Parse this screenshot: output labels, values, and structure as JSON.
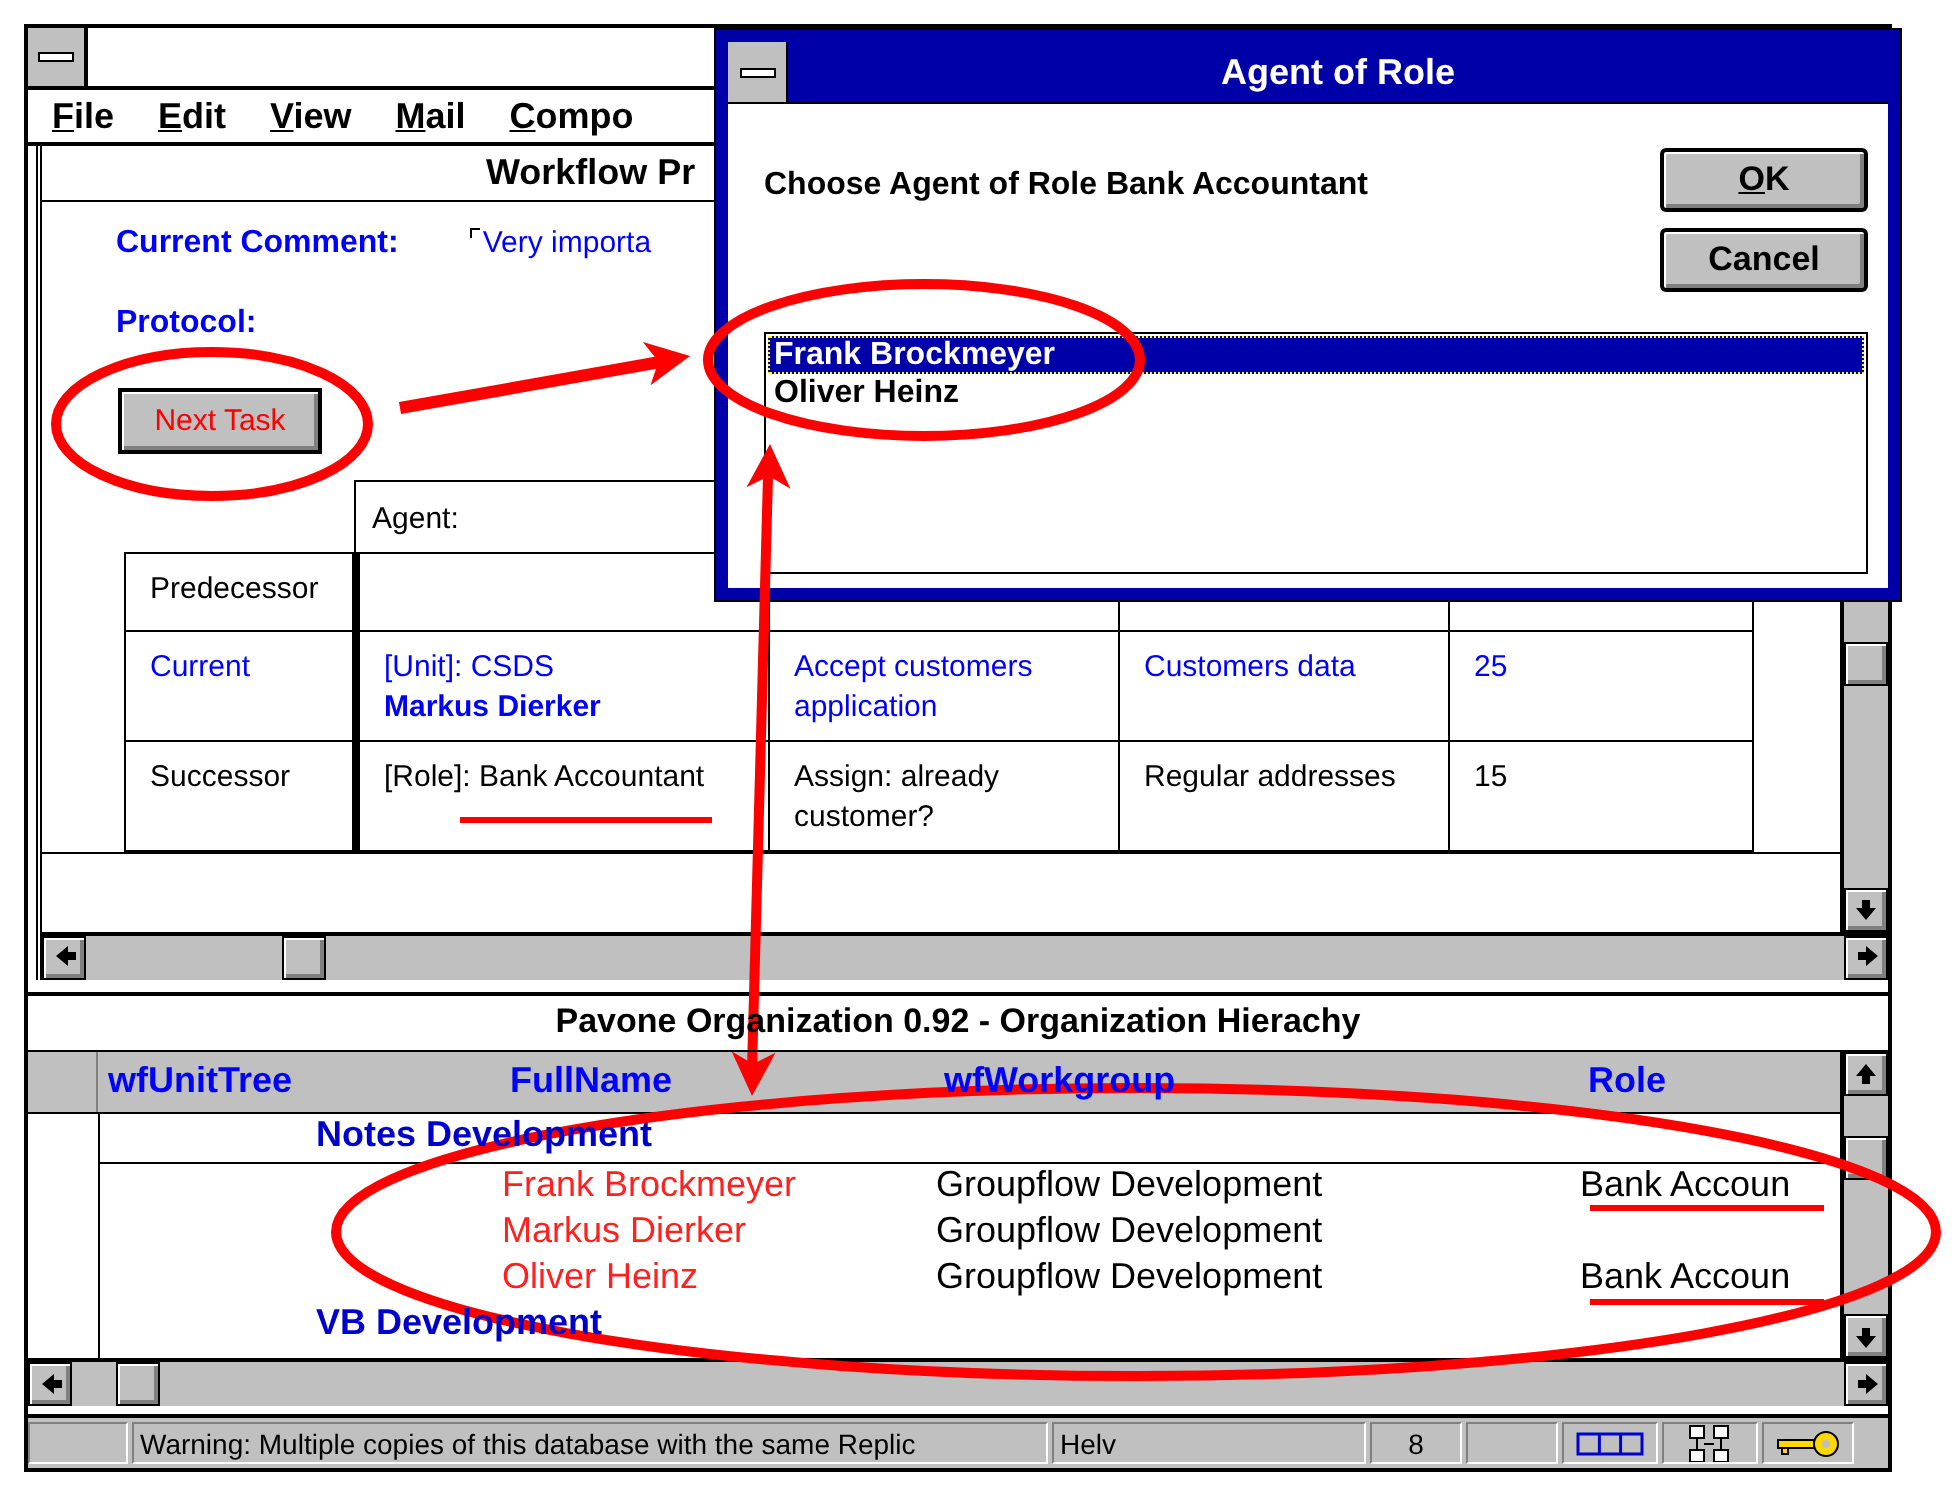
{
  "window": {
    "menu": [
      {
        "key": "F",
        "rest": "ile"
      },
      {
        "key": "E",
        "rest": "dit"
      },
      {
        "key": "V",
        "rest": "iew"
      },
      {
        "key": "M",
        "rest": "ail"
      },
      {
        "key": "C",
        "rest": "ompo"
      }
    ]
  },
  "workflow_form": {
    "title": "Workflow Pr",
    "comment_label": "Current Comment:",
    "comment_value": "Very importa",
    "protocol_label": "Protocol:",
    "next_task_button": "Next Task",
    "table": {
      "agent_header": "Agent:",
      "rows": [
        {
          "label": "Predecessor",
          "highlighted": false
        },
        {
          "label": "Current",
          "highlighted": true,
          "agent": "[Unit]: CSDS\n**Markus Dierker**",
          "task": "Accept customers application",
          "data": "Customers data",
          "column_5": "25"
        },
        {
          "label": "Successor",
          "highlighted": false,
          "agent": "[Role]: Bank Accountant",
          "task": "Assign: already customer?",
          "data": "Regular addresses",
          "column_5": "15"
        }
      ]
    }
  },
  "dialog": {
    "title": "Agent of Role",
    "prompt": "Choose Agent of Role Bank Accountant",
    "ok_button": {
      "key": "O",
      "rest": "K"
    },
    "cancel_button": "Cancel",
    "agents": [
      {
        "name": "Frank Brockmeyer",
        "selected": true
      },
      {
        "name": "Oliver Heinz",
        "selected": false
      }
    ]
  },
  "org_view": {
    "title": "Pavone Organization 0.92 - Organization Hierachy",
    "columns": [
      "wfUnitTree",
      "FullName",
      "wfWorkgroup",
      "Role"
    ],
    "rows": [
      {
        "kind": "category",
        "name": "Notes Development"
      },
      {
        "kind": "person",
        "full_name": "Frank Brockmeyer",
        "workgroup": "Groupflow Development",
        "role": "Bank Accoun"
      },
      {
        "kind": "person",
        "full_name": "Markus Dierker",
        "workgroup": "Groupflow Development"
      },
      {
        "kind": "person",
        "full_name": "Oliver Heinz",
        "workgroup": "Groupflow Development",
        "role": "Bank Accoun"
      },
      {
        "kind": "category",
        "name": "VB Development"
      }
    ]
  },
  "status_bar": {
    "message": "Warning: Multiple copies of this database with the same Replic",
    "font": "Helv",
    "size": "8"
  }
}
